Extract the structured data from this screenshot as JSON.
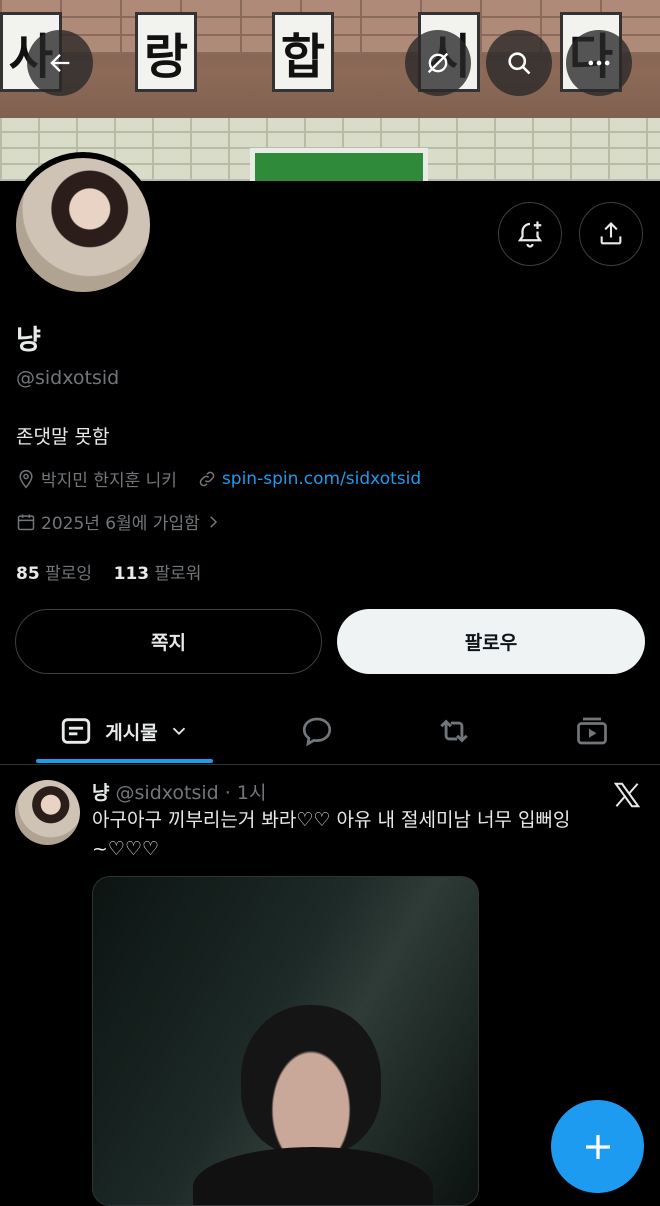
{
  "banner": {
    "sign_chars": [
      "사",
      "랑",
      "합",
      "시",
      "다"
    ]
  },
  "profile": {
    "display_name": "냥",
    "handle": "@sidxotsid",
    "bio": "존댓말 못함",
    "location": "박지민 한지훈 니키",
    "website": "spin-spin.com/sidxotsid",
    "joined": "2025년 6월에 가입함",
    "following_count": "85",
    "following_label": "팔로잉",
    "followers_count": "113",
    "followers_label": "팔로워"
  },
  "actions": {
    "message_label": "쪽지",
    "follow_label": "팔로우"
  },
  "tabs": {
    "posts_label": "게시물"
  },
  "post": {
    "name": "냥",
    "handle_time": "@sidxotsid · 1시",
    "text": "아구아구 끼부리는거 봐라♡♡ 아유 내 절세미남 너무 입뻐잉 ~♡♡♡"
  },
  "colors": {
    "accent": "#1d9bf0",
    "background": "#000000",
    "secondary_text": "#71767b"
  },
  "icons": [
    "back-arrow-icon",
    "grok-icon",
    "search-icon",
    "more-icon",
    "notification-add-icon",
    "share-icon",
    "location-icon",
    "link-icon",
    "calendar-icon",
    "chevron-right-icon",
    "posts-tab-icon",
    "chevron-down-icon",
    "reply-icon",
    "repost-icon",
    "video-icon",
    "x-logo-icon",
    "plus-icon"
  ]
}
